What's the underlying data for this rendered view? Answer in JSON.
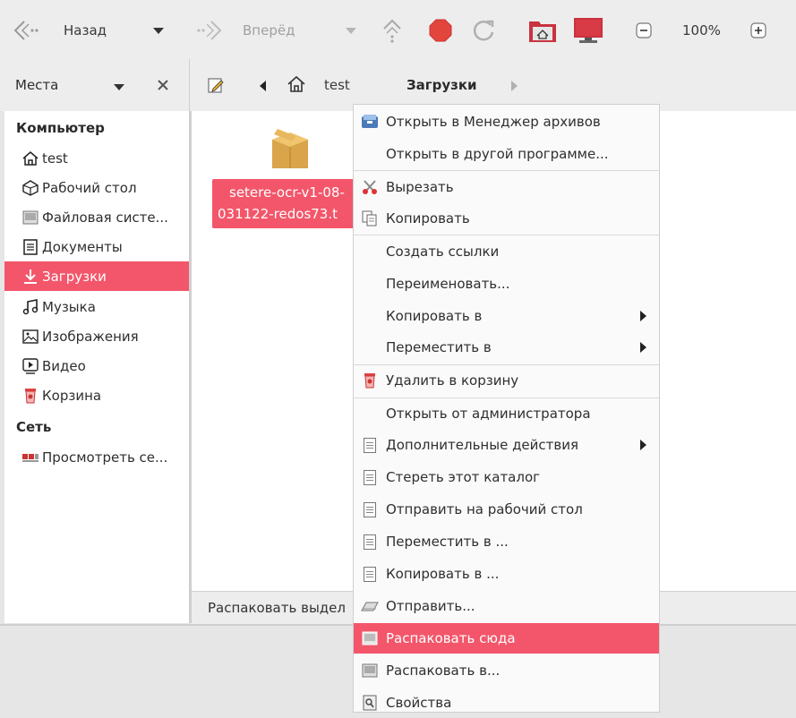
{
  "toolbar": {
    "back_label": "Назад",
    "forward_label": "Вперёд",
    "zoom_level": "100%"
  },
  "places": {
    "label": "Места"
  },
  "location": {
    "crumbs": [
      "test",
      "Загрузки"
    ]
  },
  "sidebar": {
    "computer_header": "Компьютер",
    "network_header": "Сеть",
    "items": [
      {
        "label": "test",
        "icon": "home-icon"
      },
      {
        "label": "Рабочий стол",
        "icon": "desktop-icon"
      },
      {
        "label": "Файловая систе...",
        "icon": "drive-icon"
      },
      {
        "label": "Документы",
        "icon": "documents-icon"
      },
      {
        "label": "Загрузки",
        "icon": "download-icon"
      },
      {
        "label": "Музыка",
        "icon": "music-icon"
      },
      {
        "label": "Изображения",
        "icon": "pictures-icon"
      },
      {
        "label": "Видео",
        "icon": "video-icon"
      },
      {
        "label": "Корзина",
        "icon": "trash-icon"
      }
    ],
    "network_item": "Просмотреть се...",
    "selected_color": "#f3566a"
  },
  "file": {
    "name_line1": "setere-ocr-v1-08-",
    "name_line2": "031122-redos73.t"
  },
  "status": {
    "text": "Распаковать выдел"
  },
  "context_menu": {
    "items": [
      "Открыть в Менеджер архивов",
      "Открыть в другой программе...",
      "Вырезать",
      "Копировать",
      "Создать ссылки",
      "Переименовать...",
      "Копировать в",
      "Переместить в",
      "Удалить в корзину",
      "Открыть от администратора",
      "Дополнительные действия",
      "Стереть этот каталог",
      "Отправить на рабочий стол",
      "Переместить в ...",
      "Копировать в ...",
      "Отправить...",
      "Распаковать сюда",
      "Распаковать в...",
      "Свойства"
    ]
  }
}
